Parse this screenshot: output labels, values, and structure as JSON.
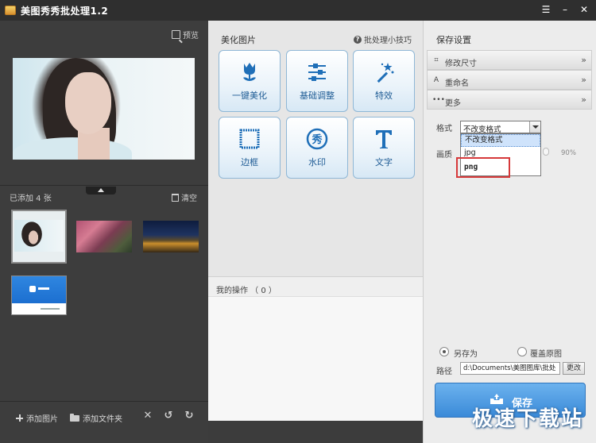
{
  "titlebar": {
    "title": "美图秀秀批处理1.2",
    "menu_icon": "menu-icon",
    "min_icon": "minimize-icon",
    "close_icon": "close-icon"
  },
  "left": {
    "preview_label": "预览",
    "added_count": "已添加 4 张",
    "clear_label": "清空",
    "thumbnails": [
      "portrait",
      "flowers",
      "night-town",
      "webpage"
    ],
    "add_image_label": "添加图片",
    "add_folder_label": "添加文件夹"
  },
  "middle": {
    "title": "美化图片",
    "tips_label": "批处理小技巧",
    "tools": [
      "一键美化",
      "基础调整",
      "特效",
      "边框",
      "水印",
      "文字"
    ],
    "ops_label": "我的操作 （ 0 ）"
  },
  "right": {
    "title": "保存设置",
    "accordion": [
      {
        "label": "修改尺寸",
        "icon": "crop-icon"
      },
      {
        "label": "重命名",
        "icon": "rename-icon"
      },
      {
        "label": "更多",
        "icon": "more-icon"
      }
    ],
    "format_label": "格式",
    "format_value": "不改变格式",
    "format_options": [
      "不改变格式",
      "jpg",
      "png"
    ],
    "quality_label": "画质",
    "quality_percent": "90%",
    "quality_value": 90,
    "save_as_label": "另存为",
    "overwrite_label": "覆盖原图",
    "path_label": "路径",
    "path_value": "d:\\Documents\\美图图库\\批处",
    "change_label": "更改",
    "save_label": "保存"
  },
  "watermark": "极速下载站",
  "colors": {
    "accent": "#3a8ad8",
    "highlight_box": "#d6393a",
    "tool_text": "#1f5c95"
  }
}
